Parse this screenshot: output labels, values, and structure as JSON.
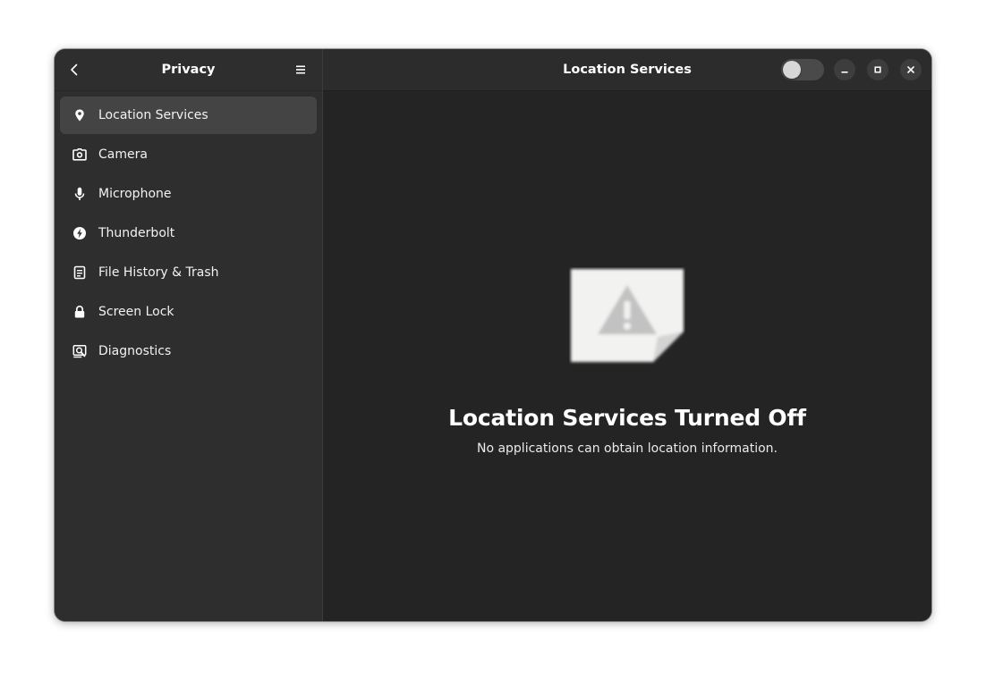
{
  "sidebar": {
    "title": "Privacy",
    "items": [
      {
        "label": "Location Services",
        "icon": "location-pin-icon",
        "selected": true
      },
      {
        "label": "Camera",
        "icon": "camera-icon"
      },
      {
        "label": "Microphone",
        "icon": "microphone-icon"
      },
      {
        "label": "Thunderbolt",
        "icon": "thunderbolt-icon"
      },
      {
        "label": "File History & Trash",
        "icon": "file-history-icon"
      },
      {
        "label": "Screen Lock",
        "icon": "lock-icon"
      },
      {
        "label": "Diagnostics",
        "icon": "diagnostics-icon"
      }
    ]
  },
  "content": {
    "title": "Location Services",
    "toggle_on": false,
    "status": {
      "icon": "warning-image-icon",
      "title": "Location Services Turned Off",
      "description": "No applications can obtain location information."
    }
  },
  "colors": {
    "window_bg": "#242424",
    "sidebar_bg": "#2e2e2e",
    "selected_row": "#444444",
    "header_bg": "#2c2c2c"
  }
}
